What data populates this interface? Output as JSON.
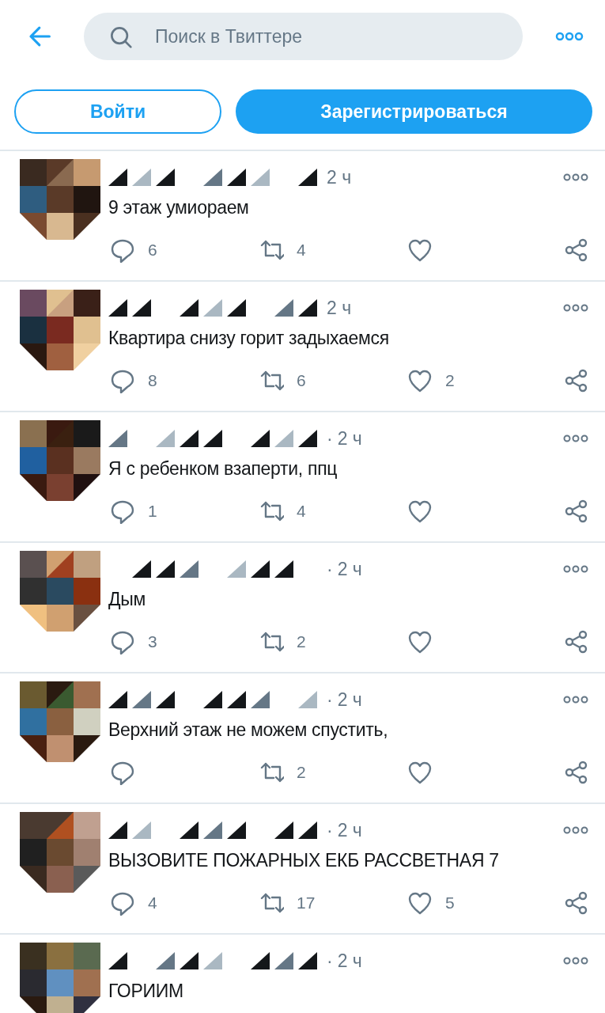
{
  "header": {
    "search": {
      "placeholder": "Поиск в Твиттере"
    }
  },
  "buttons": [
    {
      "kind": "outline",
      "label": "Войти"
    },
    {
      "kind": "filled",
      "label": "Зарегистрироваться"
    }
  ],
  "tweets": [
    {
      "time": "2 ч",
      "text": "9 этаж умиораем",
      "replies": "6",
      "retweets": "4"
    },
    {
      "time": "2 ч",
      "text": "Квартира снизу горит задыхаемся",
      "replies": "8",
      "retweets": "6",
      "likes": "2"
    },
    {
      "separator": "·",
      "time": "2 ч",
      "text": "Я с ребенком взаперти, ппц",
      "replies": "1",
      "retweets": "4"
    },
    {
      "separator": "·",
      "time": "2 ч",
      "text": "Дым",
      "replies": "3",
      "retweets": "2"
    },
    {
      "separator": "·",
      "time": "2 ч",
      "text": "Верхний этаж не можем спустить,",
      "retweets": "2"
    },
    {
      "separator": "·",
      "time": "2 ч",
      "text": "ВЫЗОВИТЕ ПОЖАРНЫХ ЕКБ РАССВЕТНАЯ 7",
      "replies": "4",
      "retweets": "17",
      "likes": "5"
    },
    {
      "separator": "·",
      "time": "2 ч",
      "text": "ГОРИИМ"
    }
  ]
}
